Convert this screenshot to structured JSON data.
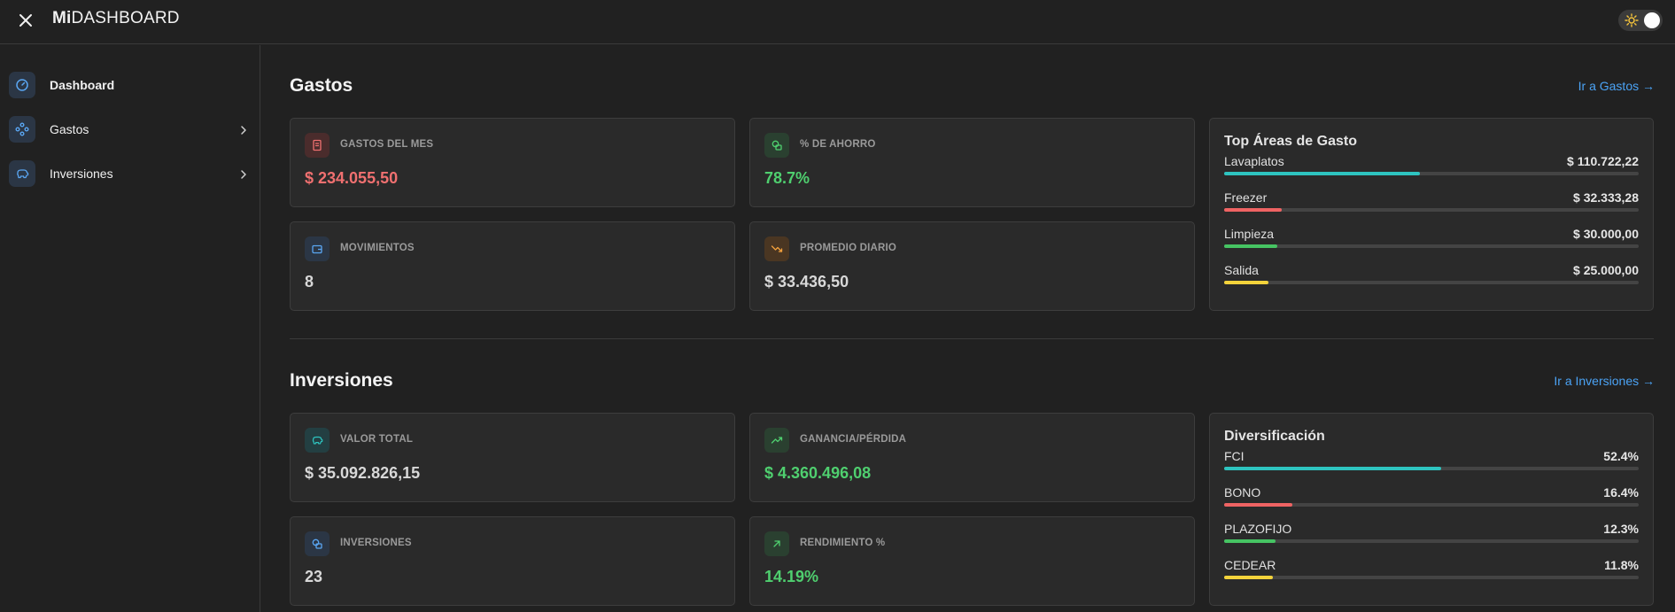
{
  "header": {
    "brand_bold": "Mi",
    "brand_rest": "DASHBOARD"
  },
  "sidebar": {
    "items": [
      {
        "label": "Dashboard",
        "icon": "gauge-icon",
        "active": true
      },
      {
        "label": "Gastos",
        "icon": "nodes-icon",
        "active": false
      },
      {
        "label": "Inversiones",
        "icon": "piggy-bank-icon",
        "active": false
      }
    ]
  },
  "gastos": {
    "title": "Gastos",
    "link": "Ir a Gastos →",
    "cards": [
      {
        "label": "GASTOS DEL MES",
        "value": "$ 234.055,50",
        "icon": "receipt-icon"
      },
      {
        "label": "% DE AHORRO",
        "value": "78.7%",
        "icon": "coins-icon"
      },
      {
        "label": "MOVIMIENTOS",
        "value": "8",
        "icon": "wallet-icon"
      },
      {
        "label": "PROMEDIO DIARIO",
        "value": "$ 33.436,50",
        "icon": "trend-down-icon"
      }
    ],
    "top": {
      "title": "Top Áreas de Gasto",
      "rows": [
        {
          "name": "Lavaplatos",
          "amount": "$ 110.722,22",
          "fraction": 0.473,
          "color": "#2ec4c0"
        },
        {
          "name": "Freezer",
          "amount": "$ 32.333,28",
          "fraction": 0.138,
          "color": "#ef6363"
        },
        {
          "name": "Limpieza",
          "amount": "$ 30.000,00",
          "fraction": 0.128,
          "color": "#46c463"
        },
        {
          "name": "Salida",
          "amount": "$ 25.000,00",
          "fraction": 0.107,
          "color": "#f3d33b"
        }
      ]
    }
  },
  "inversiones": {
    "title": "Inversiones",
    "link": "Ir a Inversiones →",
    "cards": [
      {
        "label": "VALOR TOTAL",
        "value": "$ 35.092.826,15",
        "icon": "piggy-bank-icon"
      },
      {
        "label": "GANANCIA/PÉRDIDA",
        "value": "$ 4.360.496,08",
        "icon": "trend-up-icon"
      },
      {
        "label": "INVERSIONES",
        "value": "23",
        "icon": "coins-icon"
      },
      {
        "label": "RENDIMIENTO %",
        "value": "14.19%",
        "icon": "arrow-up-right-icon"
      }
    ],
    "diversificacion": {
      "title": "Diversificación",
      "rows": [
        {
          "name": "FCI",
          "amount": "52.4%",
          "fraction": 0.524,
          "color": "#2ec4c0"
        },
        {
          "name": "BONO",
          "amount": "16.4%",
          "fraction": 0.164,
          "color": "#ef6363"
        },
        {
          "name": "PLAZOFIJO",
          "amount": "12.3%",
          "fraction": 0.123,
          "color": "#46c463"
        },
        {
          "name": "CEDEAR",
          "amount": "11.8%",
          "fraction": 0.118,
          "color": "#f3d33b"
        }
      ]
    }
  },
  "colors": {
    "accent_link": "#4ba3f5",
    "negative": "#f07070",
    "positive": "#4fcf6f"
  }
}
